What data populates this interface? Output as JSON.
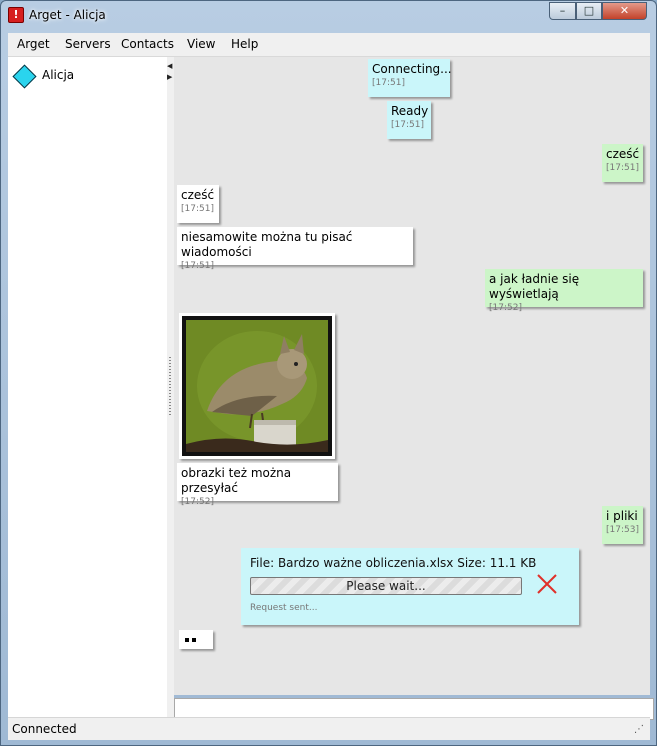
{
  "window": {
    "title": "Arget - Alicja",
    "app_icon": "arget-app-icon",
    "controls": {
      "minimize": "–",
      "maximize": "□",
      "close": "✕"
    }
  },
  "menu": [
    "Arget",
    "Servers",
    "Contacts",
    "View",
    "Help"
  ],
  "contacts": [
    {
      "name": "Alicja",
      "icon": "cyan-diamond-icon",
      "status_color": "#2ad4ee"
    }
  ],
  "messages": [
    {
      "text": "Connecting...",
      "time": "[17:51]",
      "style": "system"
    },
    {
      "text": "Ready",
      "time": "[17:51]",
      "style": "system"
    },
    {
      "text": "cześć",
      "time": "[17:51]",
      "style": "sent"
    },
    {
      "text": "cześć",
      "time": "[17:51]",
      "style": "received"
    },
    {
      "text": "niesamowite można tu pisać wiadomości",
      "time": "[17:51]",
      "style": "received"
    },
    {
      "text": "a jak ładnie się wyświetlają",
      "time": "[17:52]",
      "style": "sent"
    },
    {
      "text": "obrazki też można przesyłać",
      "time": "[17:52]",
      "style": "received"
    },
    {
      "text": "i pliki",
      "time": "[17:53]",
      "style": "sent"
    }
  ],
  "image_message": {
    "icon": "bird-cat-photo"
  },
  "file_transfer": {
    "info": "File: Bardzo ważne obliczenia.xlsx Size: 11.1 KB",
    "progress_label": "Please wait...",
    "progress_fraction": 0.0,
    "status": "Request sent...",
    "cancel_icon": "red-x-icon"
  },
  "typing_indicator": {
    "icon": "typing-dots-icon"
  },
  "message_input": {
    "value": ""
  },
  "statusbar": {
    "text": "Connected",
    "grip_icon": "resize-grip-icon"
  },
  "colors": {
    "sent_bubble": "#ccf5c8",
    "received_bubble": "#ffffff",
    "system_bubble": "#caf6fa",
    "chat_background": "#e6e6e6",
    "cancel_red": "#e0302a"
  }
}
